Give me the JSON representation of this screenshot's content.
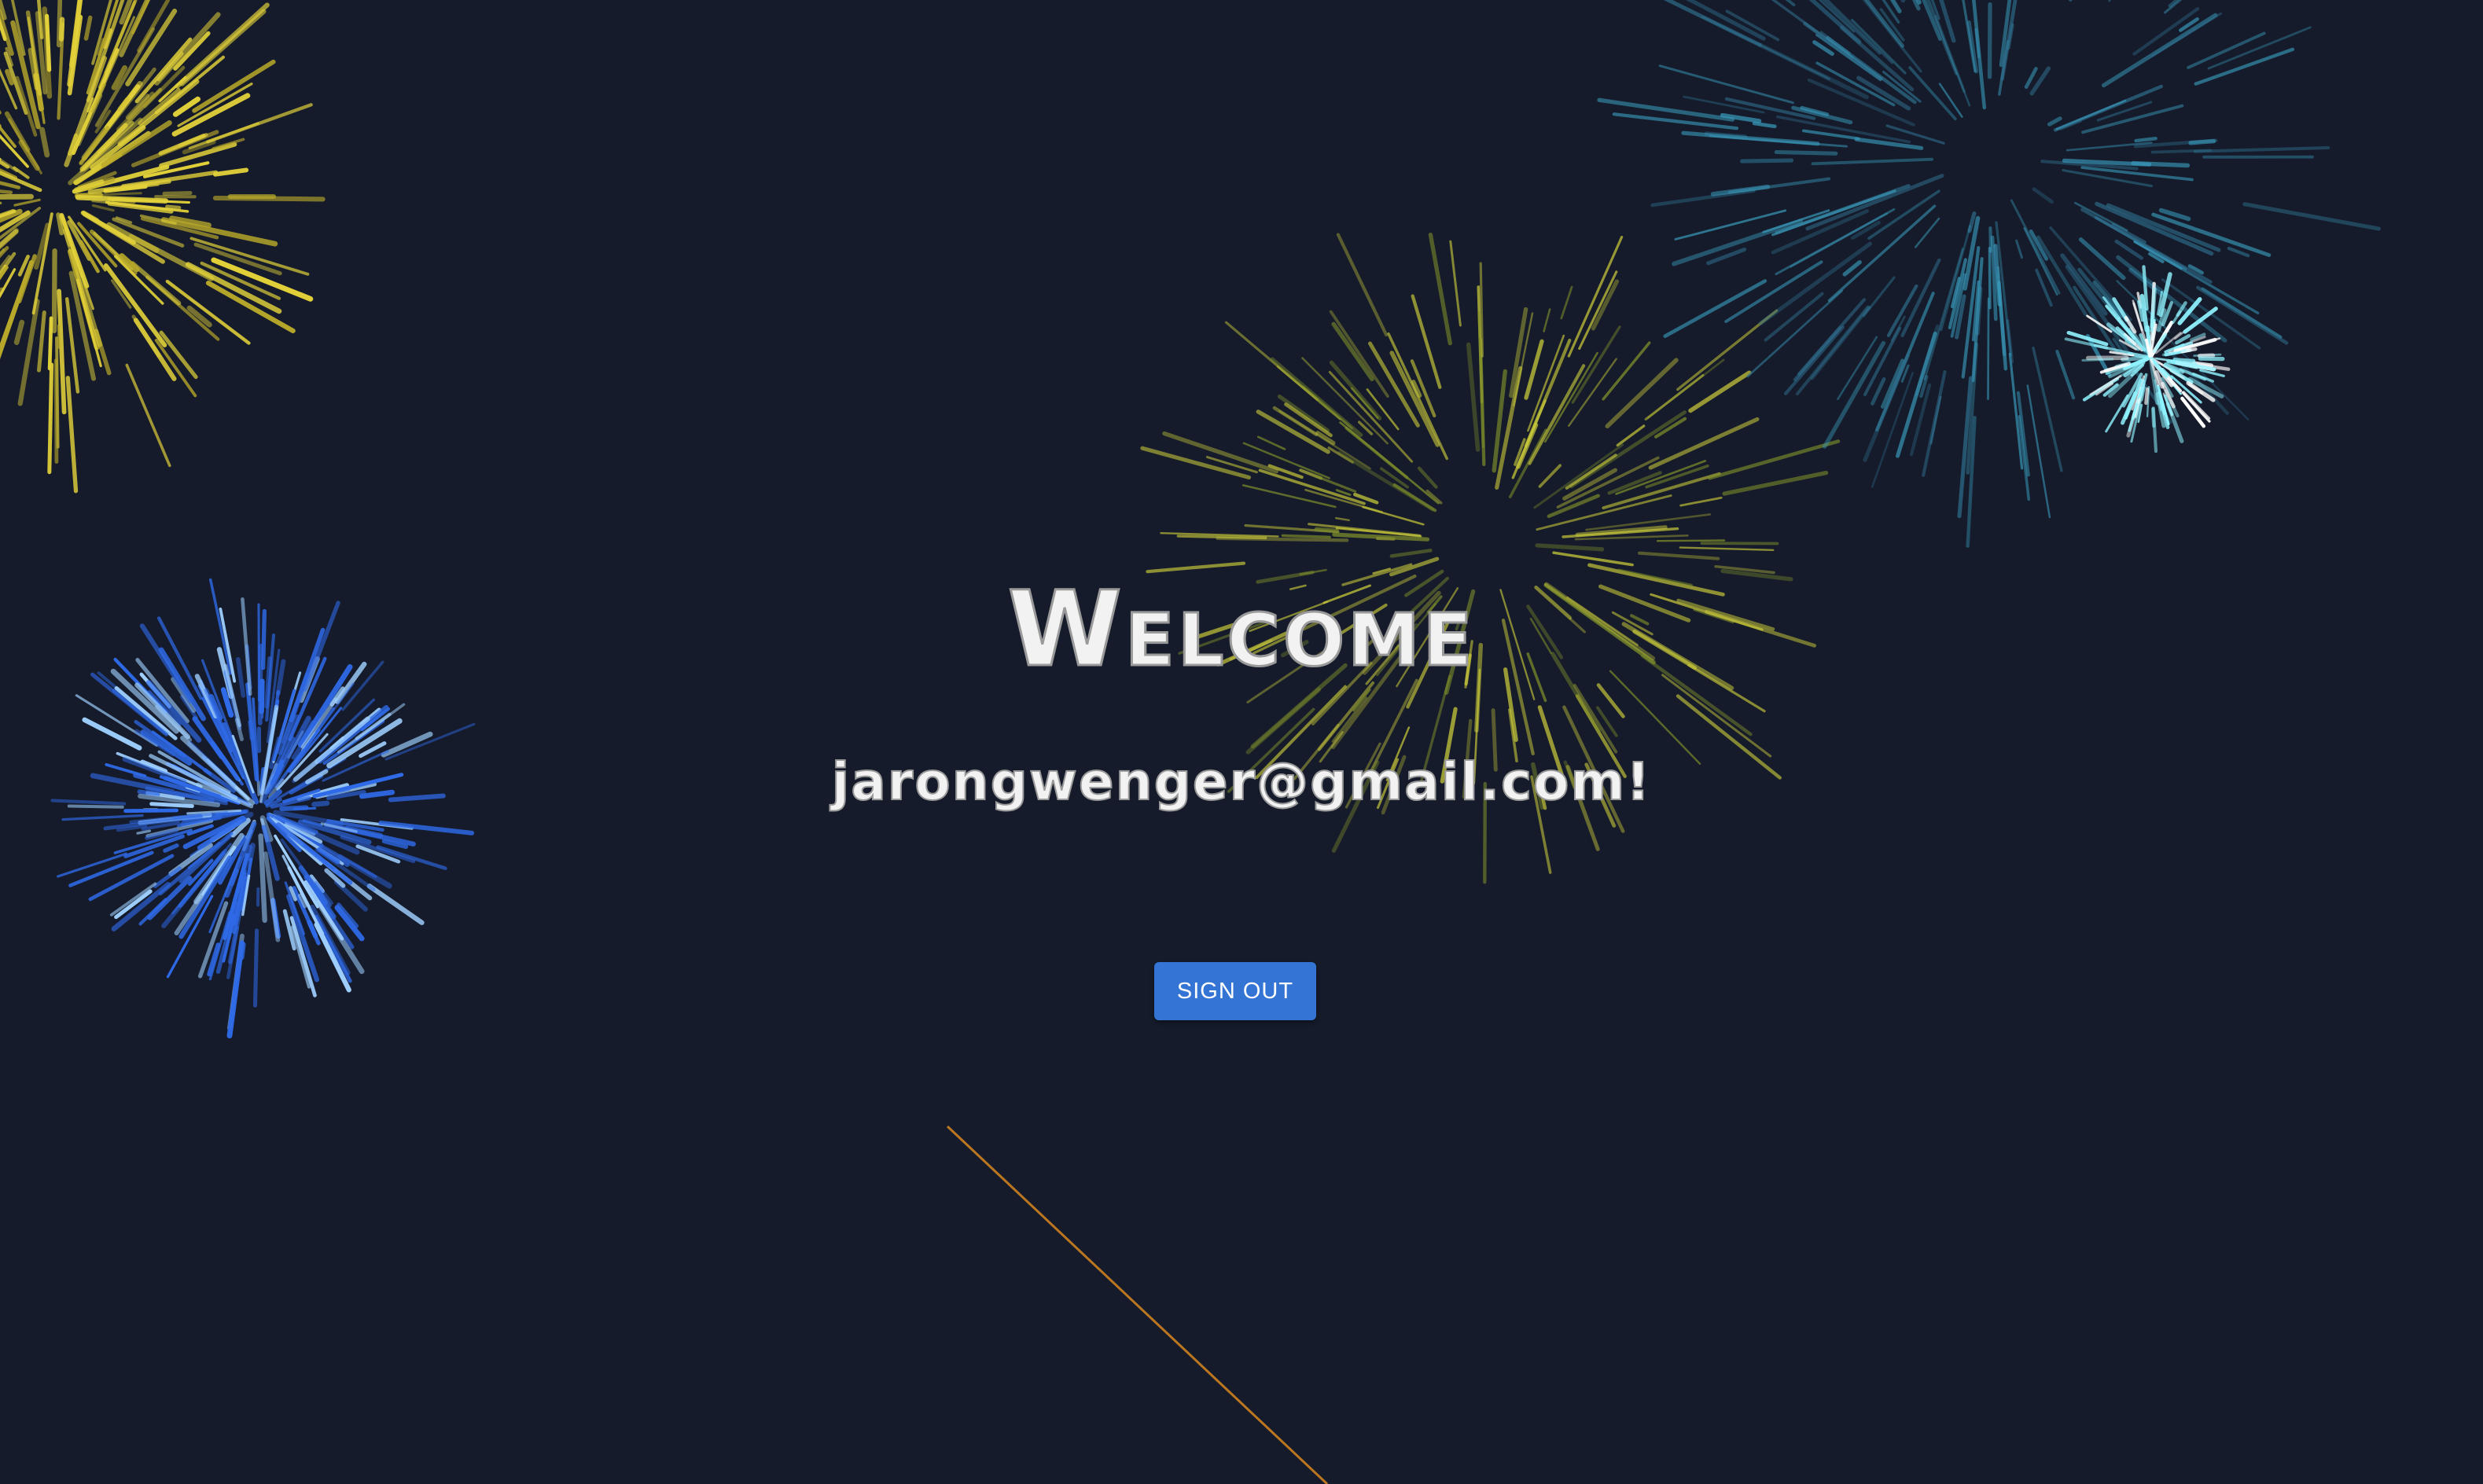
{
  "greeting": {
    "title": "Welcome",
    "email": "jarongwenger@gmail.com!"
  },
  "actions": {
    "sign_out_label": "SIGN OUT"
  },
  "colors": {
    "background": "#151b2a",
    "button": "#3474d4",
    "text": "#f2f2f2",
    "firework_yellow": "#e3d23a",
    "firework_blue": "#2f6ae8",
    "firework_cyan": "#8ff3ff",
    "firework_teal": "#3a9ec0",
    "trail_orange": "#d9861f"
  }
}
